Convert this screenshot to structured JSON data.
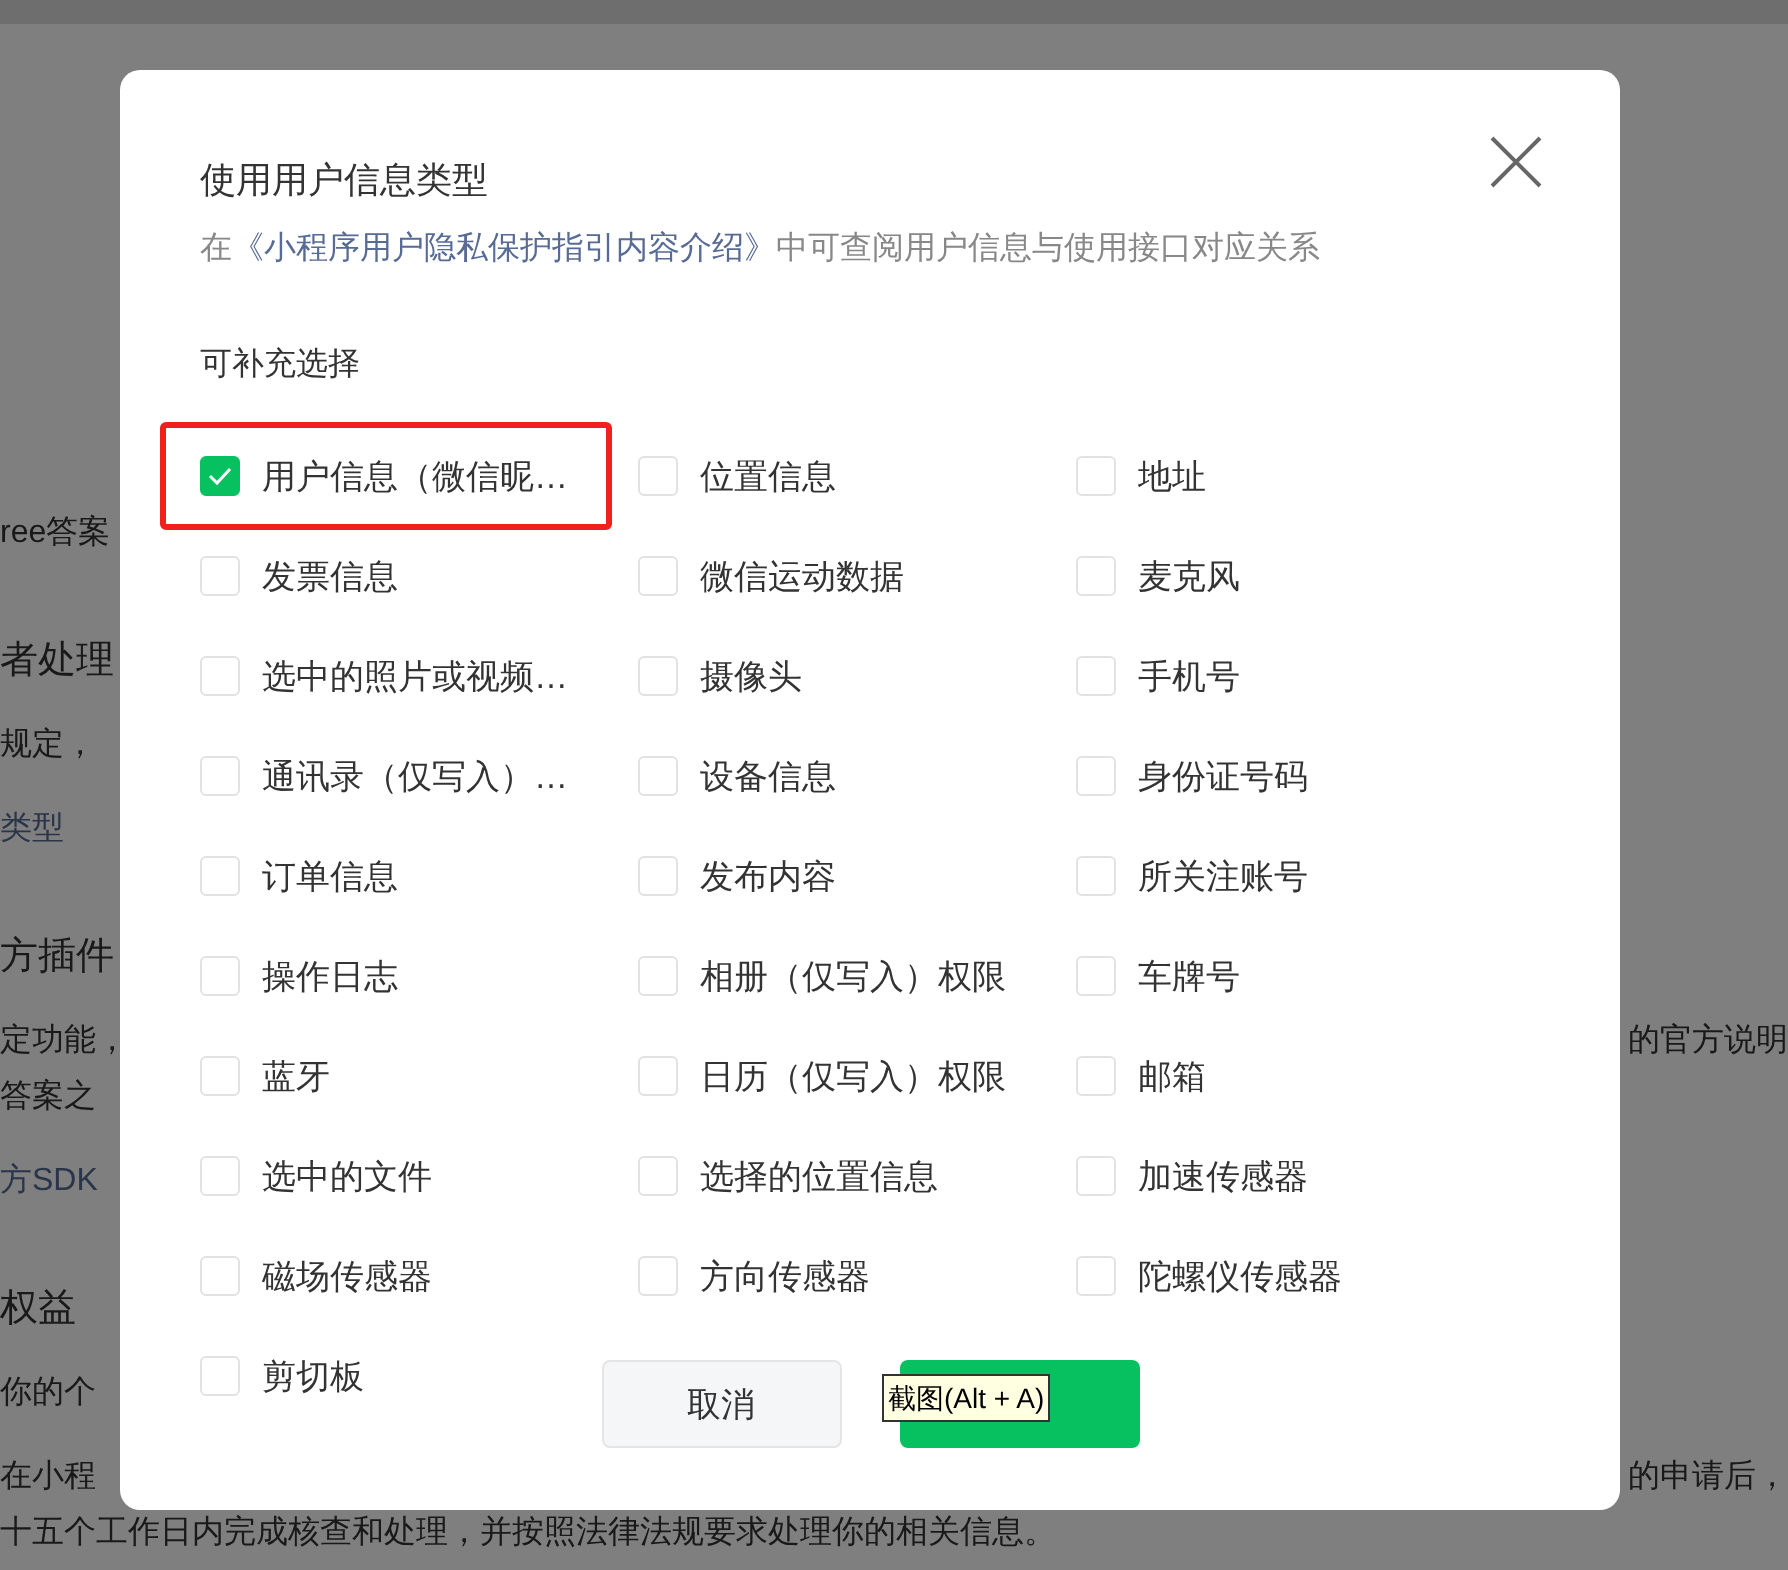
{
  "background_page": {
    "blocks": [
      {
        "kind": "body",
        "lines": [
          {
            "left": "ree答案"
          }
        ]
      },
      {
        "kind": "heading",
        "lines": [
          {
            "left": "者处理"
          }
        ]
      },
      {
        "kind": "body",
        "lines": [
          {
            "left": "规定，"
          }
        ]
      },
      {
        "kind": "link",
        "lines": [
          {
            "left": "类型"
          }
        ]
      },
      {
        "kind": "heading",
        "lines": [
          {
            "left": "方插件"
          }
        ]
      },
      {
        "kind": "body",
        "lines": [
          {
            "left": "定功能，",
            "right": "的官方说明"
          },
          {
            "left": "答案之"
          }
        ]
      },
      {
        "kind": "link",
        "lines": [
          {
            "left": "方SDK"
          }
        ]
      },
      {
        "kind": "heading",
        "lines": [
          {
            "left": "权益"
          }
        ]
      },
      {
        "kind": "body",
        "lines": [
          {
            "left": "你的个"
          }
        ]
      },
      {
        "kind": "body",
        "lines": [
          {
            "left": "在小程",
            "right": "的申请后，"
          },
          {
            "left": "十五个工作日内完成核查和处理，并按照法律法规要求处理你的相关信息。"
          }
        ]
      }
    ]
  },
  "modal": {
    "title": "使用用户信息类型",
    "description": {
      "prefix": "在",
      "link": "《小程序用户隐私保护指引内容介绍》",
      "suffix": "中可查阅用户信息与使用接口对应关系"
    },
    "section_label": "可补充选择",
    "options": [
      {
        "label": "用户信息（微信昵…",
        "checked": true,
        "highlighted": true
      },
      {
        "label": "位置信息",
        "checked": false,
        "highlighted": false
      },
      {
        "label": "地址",
        "checked": false,
        "highlighted": false
      },
      {
        "label": "发票信息",
        "checked": false,
        "highlighted": false
      },
      {
        "label": "微信运动数据",
        "checked": false,
        "highlighted": false
      },
      {
        "label": "麦克风",
        "checked": false,
        "highlighted": false
      },
      {
        "label": "选中的照片或视频…",
        "checked": false,
        "highlighted": false
      },
      {
        "label": "摄像头",
        "checked": false,
        "highlighted": false
      },
      {
        "label": "手机号",
        "checked": false,
        "highlighted": false
      },
      {
        "label": "通讯录（仅写入）…",
        "checked": false,
        "highlighted": false
      },
      {
        "label": "设备信息",
        "checked": false,
        "highlighted": false
      },
      {
        "label": "身份证号码",
        "checked": false,
        "highlighted": false
      },
      {
        "label": "订单信息",
        "checked": false,
        "highlighted": false
      },
      {
        "label": "发布内容",
        "checked": false,
        "highlighted": false
      },
      {
        "label": "所关注账号",
        "checked": false,
        "highlighted": false
      },
      {
        "label": "操作日志",
        "checked": false,
        "highlighted": false
      },
      {
        "label": "相册（仅写入）权限",
        "checked": false,
        "highlighted": false
      },
      {
        "label": "车牌号",
        "checked": false,
        "highlighted": false
      },
      {
        "label": "蓝牙",
        "checked": false,
        "highlighted": false
      },
      {
        "label": "日历（仅写入）权限",
        "checked": false,
        "highlighted": false
      },
      {
        "label": "邮箱",
        "checked": false,
        "highlighted": false
      },
      {
        "label": "选中的文件",
        "checked": false,
        "highlighted": false
      },
      {
        "label": "选择的位置信息",
        "checked": false,
        "highlighted": false
      },
      {
        "label": "加速传感器",
        "checked": false,
        "highlighted": false
      },
      {
        "label": "磁场传感器",
        "checked": false,
        "highlighted": false
      },
      {
        "label": "方向传感器",
        "checked": false,
        "highlighted": false
      },
      {
        "label": "陀螺仪传感器",
        "checked": false,
        "highlighted": false
      },
      {
        "label": "剪切板",
        "checked": false,
        "highlighted": false
      }
    ],
    "buttons": [
      {
        "kind": "secondary",
        "label": "取消"
      },
      {
        "kind": "primary"
      }
    ],
    "tooltip": {
      "text": "截图(Alt + A)"
    }
  }
}
